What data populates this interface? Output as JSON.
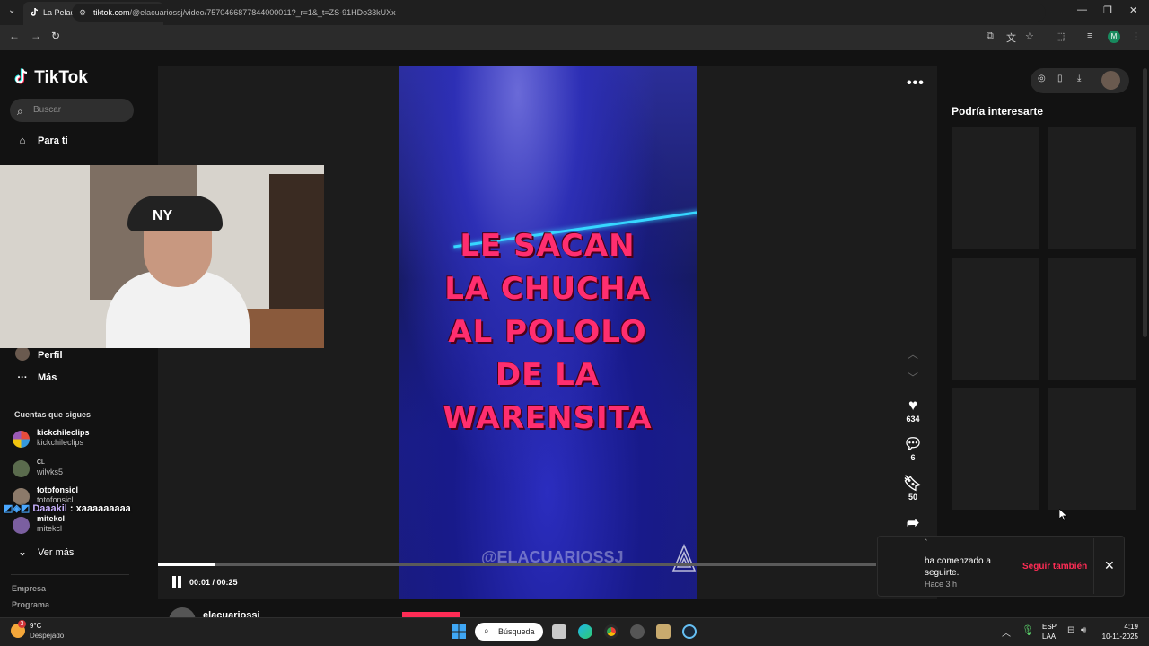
{
  "browser": {
    "tab_title": "La Pelada del Año: Watons",
    "url_host": "tiktok.com",
    "url_path": "/@elacuariossj/video/7570466877844000011?_r=1&_t=ZS-91HDo33kUXx"
  },
  "sidebar": {
    "logo": "TikTok",
    "search_placeholder": "Buscar",
    "nav": {
      "para_ti": "Para ti",
      "perfil": "Perfil",
      "mas": "Más"
    },
    "following_heading": "Cuentas que sigues",
    "accounts": [
      {
        "name": "kickchileclips",
        "handle": "kickchileclips"
      },
      {
        "name": "CL",
        "handle": "wilyks5"
      },
      {
        "name": "totofonsicl",
        "handle": "totofonsicl"
      },
      {
        "name": "mitekcl",
        "handle": "mitekcl"
      }
    ],
    "ver_mas": "Ver más",
    "footer": [
      "Empresa",
      "Programa"
    ]
  },
  "video": {
    "overlay_lines": [
      "LE SACAN",
      "LA CHUCHA",
      "AL POLOLO",
      "DE LA",
      "WARENSITA"
    ],
    "watermark": "@ELACUARIOSSJ",
    "likes": "634",
    "comments": "6",
    "saves": "50",
    "time": "00:01 / 00:25",
    "progress": 0.08,
    "author": "elacuariossj"
  },
  "webcam": {
    "cap_text": "NY"
  },
  "chat": {
    "user": "Daaakil",
    "message": ": xaaaaaaaaa"
  },
  "right_panel": {
    "title": "Podría interesarte"
  },
  "notification": {
    "tick": "`",
    "message": "ha comenzado a seguirte.",
    "when": "Hace 3 h",
    "action": "Seguir también"
  },
  "taskbar": {
    "weather_badge": "3",
    "temperature": "9°C",
    "condition": "Despejado",
    "search": "Búsqueda",
    "lang1": "ESP",
    "lang2": "LAA",
    "time": "4:19",
    "date": "10-11-2025"
  },
  "colors": {
    "tiktok_red": "#fe2c55",
    "overlay_text": "#ff2e6f",
    "neon_cyan": "#36d7ff"
  }
}
